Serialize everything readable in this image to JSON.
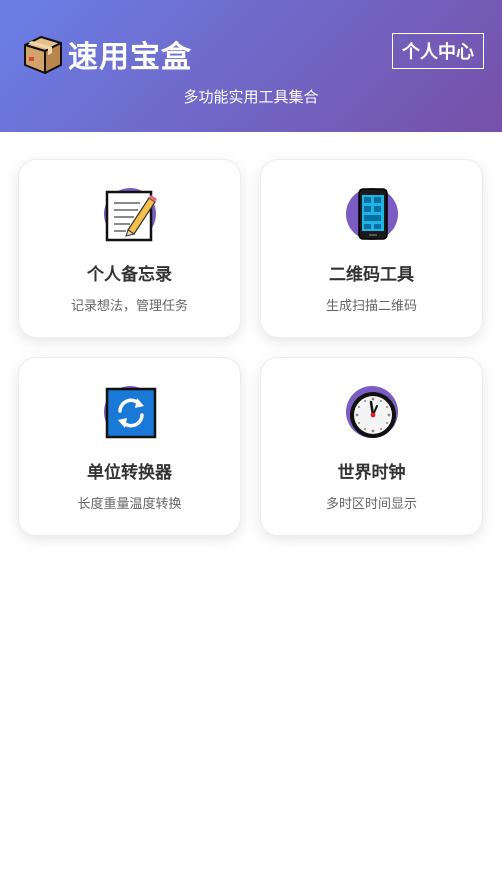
{
  "header": {
    "title": "速用宝盒",
    "subtitle": "多功能实用工具集合",
    "profile_label": "个人中心",
    "logo_icon": "package-box-icon"
  },
  "tools": [
    {
      "icon": "memo-icon",
      "title": "个人备忘录",
      "desc": "记录想法，管理任务"
    },
    {
      "icon": "mobile-phone-icon",
      "title": "二维码工具",
      "desc": "生成扫描二维码"
    },
    {
      "icon": "refresh-arrows-icon",
      "title": "单位转换器",
      "desc": "长度重量温度转换"
    },
    {
      "icon": "clock-icon",
      "title": "世界时钟",
      "desc": "多时区时间显示"
    }
  ],
  "colors": {
    "header_gradient_start": "#6a7fe6",
    "header_gradient_end": "#7650a8",
    "icon_circle": "#7b5cc3",
    "title_text": "#333333",
    "desc_text": "#666666"
  }
}
